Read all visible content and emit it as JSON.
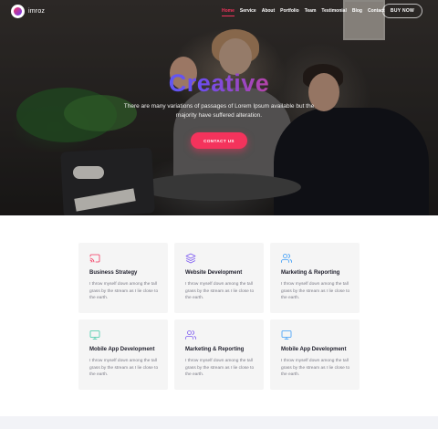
{
  "nav": {
    "logo_text": "imroz",
    "menu": [
      "Home",
      "Service",
      "About",
      "Portfolio",
      "Team",
      "Testimonial",
      "Blog",
      "Contact"
    ],
    "active_index": 0,
    "buy_label": "BUY NOW"
  },
  "hero": {
    "title": "Creative",
    "subtitle": "There are many variations of passages of Lorem Ipsum available but the majority have suffered alteration.",
    "cta_label": "CONTACT US"
  },
  "services": [
    {
      "icon": "cast-icon",
      "title": "Business Strategy",
      "text": "I throw myself down among the tall grass by the stream as I lie close to the earth."
    },
    {
      "icon": "layers-icon",
      "title": "Website Development",
      "text": "I throw myself down among the tall grass by the stream as I lie close to the earth."
    },
    {
      "icon": "users-icon",
      "title": "Marketing & Reporting",
      "text": "I throw myself down among the tall grass by the stream as I lie close to the earth."
    },
    {
      "icon": "monitor-icon",
      "title": "Mobile App Development",
      "text": "I throw myself down among the tall grass by the stream as I lie close to the earth."
    },
    {
      "icon": "users-icon",
      "title": "Marketing & Reporting",
      "text": "I throw myself down among the tall grass by the stream as I lie close to the earth."
    },
    {
      "icon": "monitor-icon",
      "title": "Mobile App Development",
      "text": "I throw myself down among the tall grass by the stream as I lie close to the earth."
    }
  ],
  "colors": {
    "accent": "#f4335c",
    "gradient_start": "#f4335c",
    "gradient_end": "#6a3cf7"
  }
}
